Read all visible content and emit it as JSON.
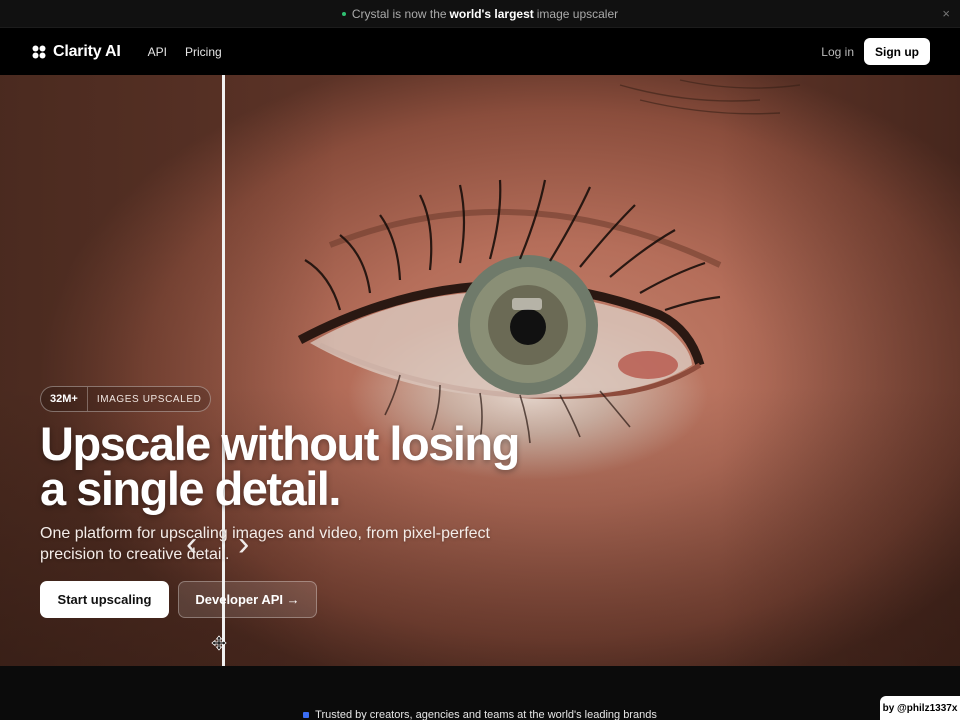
{
  "announcement": {
    "prefix": "Crystal is now the",
    "bold": "world's largest",
    "suffix": "image upscaler",
    "close": "×"
  },
  "nav": {
    "brand": "Clarity AI",
    "links": [
      "API",
      "Pricing"
    ],
    "login": "Log in",
    "signup": "Sign up"
  },
  "hero": {
    "badge_count": "32M+",
    "badge_label": "IMAGES UPSCALED",
    "headline_line1": "Upscale without losing",
    "headline_line2": "a single detail.",
    "subtitle": "One platform for upscaling images and video, from pixel-perfect precision to creative detail.",
    "primary_cta": "Start upscaling",
    "secondary_cta": "Developer API →",
    "compare_left_arrow": "‹",
    "compare_right_arrow": "›"
  },
  "footer": {
    "trusted_text": "Trusted by creators, agencies and teams at the world's leading brands",
    "credit": "by @philz1337x"
  },
  "colors": {
    "accent_green": "#2fbf71",
    "accent_blue": "#3b6ef5",
    "background": "#000000"
  }
}
